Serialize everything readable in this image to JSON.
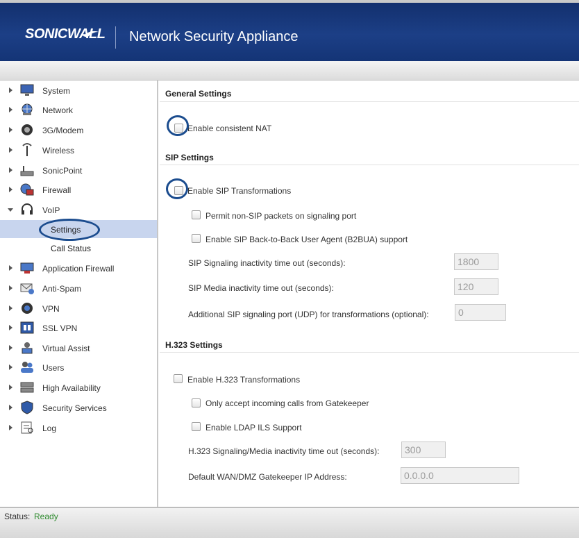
{
  "header": {
    "brand": "SONICWALL",
    "title": "Network Security Appliance"
  },
  "sidebar": {
    "items": [
      {
        "label": "System",
        "icon": "monitor-icon"
      },
      {
        "label": "Network",
        "icon": "globe-icon"
      },
      {
        "label": "3G/Modem",
        "icon": "modem-icon"
      },
      {
        "label": "Wireless",
        "icon": "antenna-icon"
      },
      {
        "label": "SonicPoint",
        "icon": "access-point-icon"
      },
      {
        "label": "Firewall",
        "icon": "firewall-icon"
      },
      {
        "label": "VoIP",
        "icon": "headset-icon",
        "expanded": true
      },
      {
        "label": "Application Firewall",
        "icon": "app-firewall-icon"
      },
      {
        "label": "Anti-Spam",
        "icon": "anti-spam-icon"
      },
      {
        "label": "VPN",
        "icon": "vpn-icon"
      },
      {
        "label": "SSL VPN",
        "icon": "ssl-vpn-icon"
      },
      {
        "label": "Virtual Assist",
        "icon": "virtual-assist-icon"
      },
      {
        "label": "Users",
        "icon": "users-icon"
      },
      {
        "label": "High Availability",
        "icon": "high-availability-icon"
      },
      {
        "label": "Security Services",
        "icon": "shield-icon"
      },
      {
        "label": "Log",
        "icon": "log-icon"
      }
    ],
    "voip_sub": [
      {
        "label": "Settings",
        "selected": true
      },
      {
        "label": "Call Status",
        "selected": false
      }
    ]
  },
  "general": {
    "title": "General Settings",
    "consistent_nat": "Enable consistent NAT"
  },
  "sip": {
    "title": "SIP Settings",
    "transformations": "Enable SIP Transformations",
    "permit_non_sip": "Permit non-SIP packets on signaling port",
    "b2bua": "Enable SIP Back-to-Back User Agent (B2BUA) support",
    "signaling_timeout_label": "SIP Signaling inactivity time out (seconds):",
    "signaling_timeout_value": "1800",
    "media_timeout_label": "SIP Media inactivity time out (seconds):",
    "media_timeout_value": "120",
    "additional_port_label": "Additional SIP signaling port (UDP) for transformations (optional):",
    "additional_port_value": "0"
  },
  "h323": {
    "title": "H.323 Settings",
    "transformations": "Enable H.323 Transformations",
    "gatekeeper_only": "Only accept incoming calls from Gatekeeper",
    "ldap_ils": "Enable LDAP ILS Support",
    "timeout_label": "H.323 Signaling/Media inactivity time out (seconds):",
    "timeout_value": "300",
    "gatekeeper_ip_label": "Default WAN/DMZ Gatekeeper IP Address:",
    "gatekeeper_ip_value": "0.0.0.0"
  },
  "status": {
    "key": "Status:",
    "value": "Ready"
  },
  "colors": {
    "header_bg": "#1c3f86",
    "selected_bg": "#c8d5ee",
    "status_ok": "#2e8b2e",
    "highlight_circle": "#1b4c8e"
  }
}
